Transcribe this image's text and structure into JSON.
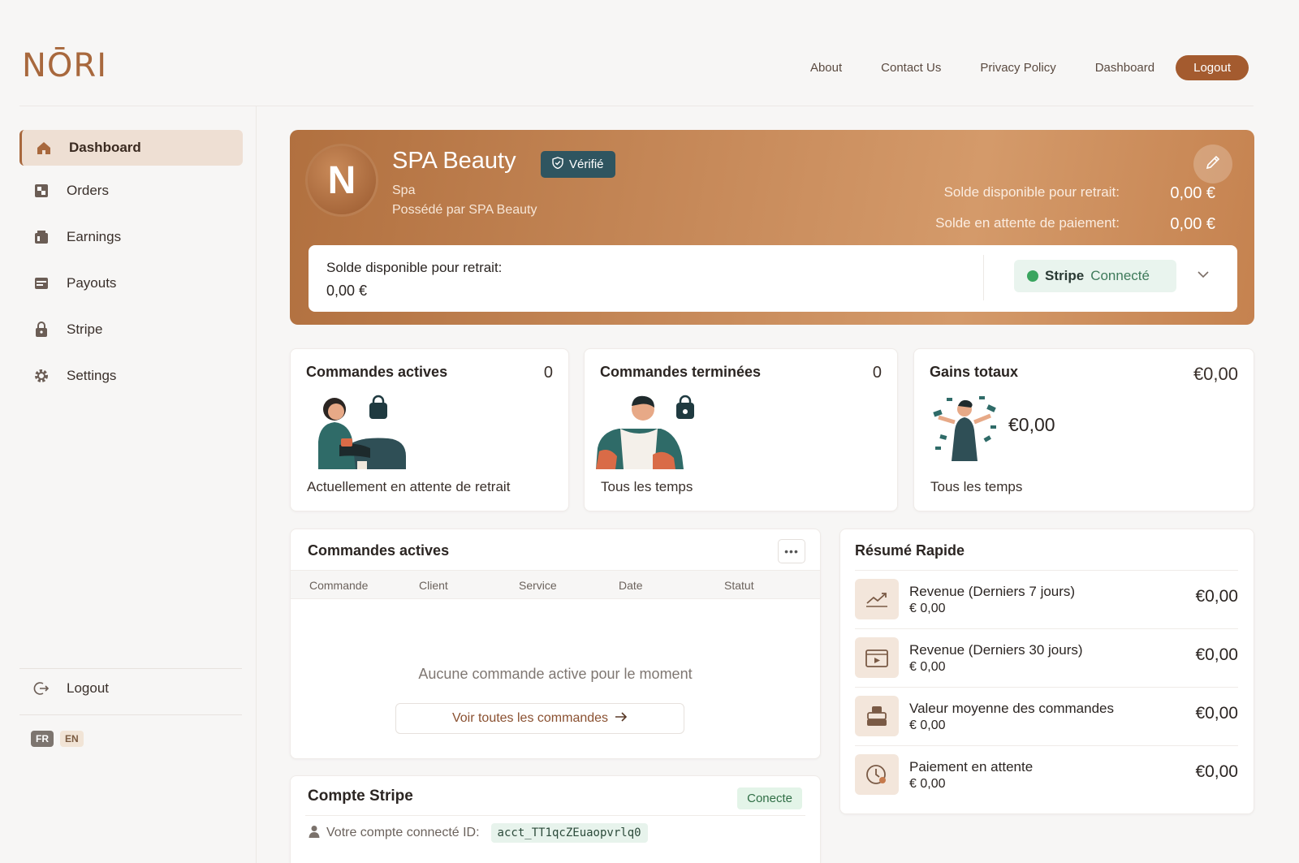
{
  "brand": {
    "logo": "NŌRI",
    "accent": "#a8683d"
  },
  "topnav": {
    "items": [
      "About",
      "Contact Us",
      "Privacy Policy",
      "Dashboard"
    ],
    "logout": "Logout"
  },
  "sidebar": {
    "items": [
      {
        "label": "Dashboard",
        "icon": "home-icon",
        "active": true
      },
      {
        "label": "Orders",
        "icon": "orders-icon"
      },
      {
        "label": "Earnings",
        "icon": "earnings-icon"
      },
      {
        "label": "Payouts",
        "icon": "payouts-icon"
      },
      {
        "label": "Stripe",
        "icon": "lock-icon"
      },
      {
        "label": "Settings",
        "icon": "gear-icon"
      }
    ],
    "logout": "Logout",
    "languages": [
      "FR",
      "EN"
    ]
  },
  "hero": {
    "initial": "N",
    "business_name": "SPA Beauty",
    "verified": "Vérifié",
    "type": "Spa",
    "owner": "Possédé par SPA Beauty",
    "available_label": "Solde disponible pour retrait:",
    "available_value": "0,00 €",
    "pending_label": "Solde en attente de paiement:",
    "pending_value": "0,00 €",
    "card_label": "Solde disponible pour retrait:",
    "card_value": "0,00 €",
    "stripe_name": "Stripe",
    "stripe_status": "Connecté"
  },
  "stats": [
    {
      "title": "Commandes actives",
      "count": "0",
      "subtitle": "Actuellement en attente de retrait"
    },
    {
      "title": "Commandes terminées",
      "count": "0",
      "subtitle": "Tous les temps"
    },
    {
      "title": "Gains totaux",
      "count": "€0,00",
      "amount": "€0,00",
      "subtitle": "Tous les temps"
    }
  ],
  "active_orders": {
    "title": "Commandes actives",
    "columns": [
      "Commande",
      "Client",
      "Service",
      "Date",
      "Statut"
    ],
    "empty": "Aucune commande active pour le moment",
    "view_all": "Voir toutes les commandes"
  },
  "summary": {
    "title": "Résumé Rapide",
    "rows": [
      {
        "label": "Revenue (Derniers 7 jours)",
        "sub": "€ 0,00",
        "value": "€0,00",
        "icon": "trend-chart-icon"
      },
      {
        "label": "Revenue (Derniers 30 jours)",
        "sub": "€ 0,00",
        "value": "€0,00",
        "icon": "video-calendar-icon"
      },
      {
        "label": "Valeur moyenne des commandes",
        "sub": "€ 0,00",
        "value": "€0,00",
        "icon": "cash-register-icon"
      },
      {
        "label": "Paiement en attente",
        "sub": "€ 0,00",
        "value": "€0,00",
        "icon": "clock-icon"
      }
    ]
  },
  "stripe_account": {
    "title": "Compte Stripe",
    "badge": "Conecte",
    "id_label": "Votre compte connecté ID:",
    "account_id": "acct_TT1qcZEuaopvrlq0"
  }
}
